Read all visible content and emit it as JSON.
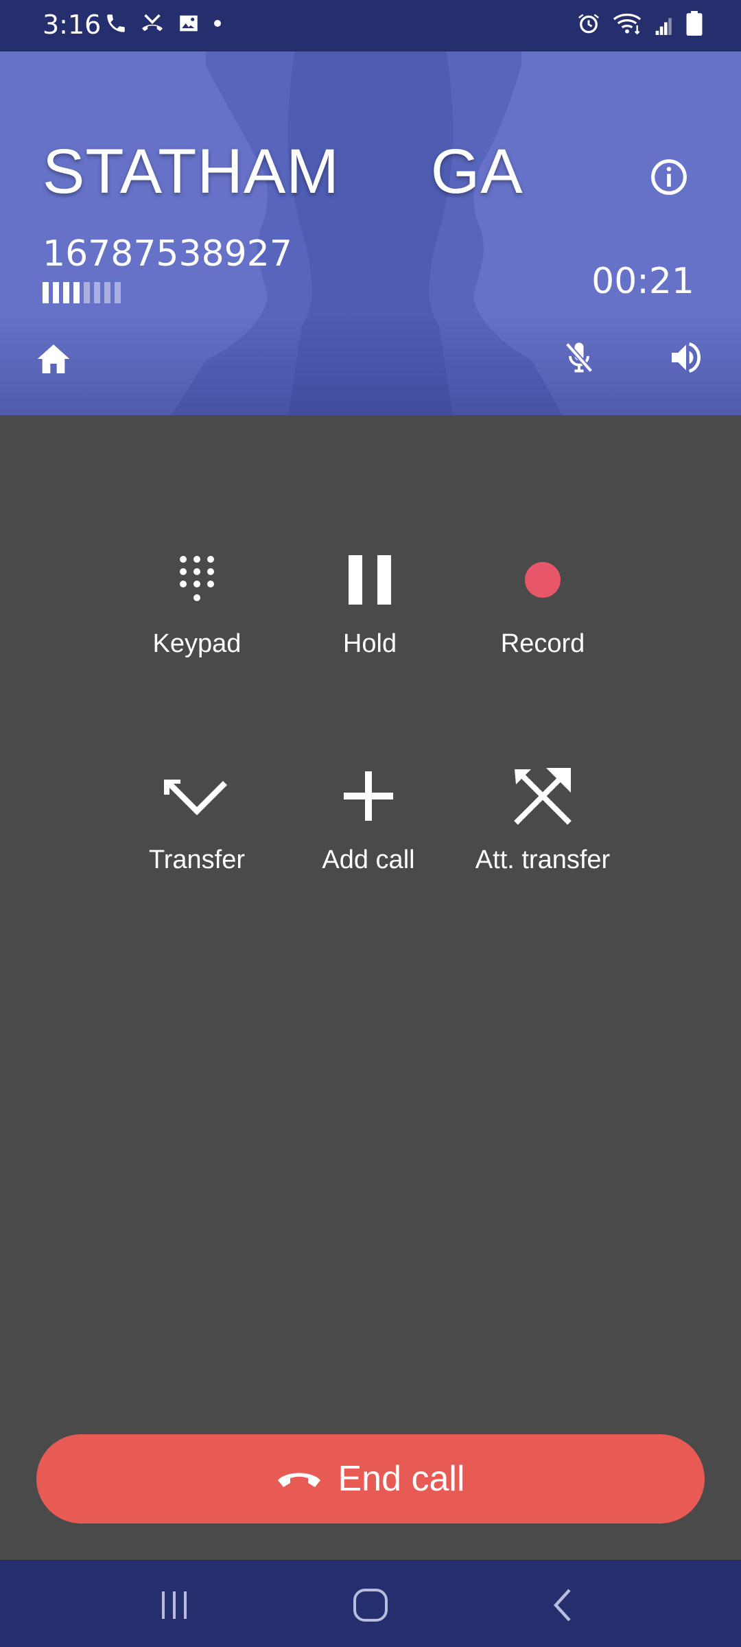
{
  "status_bar": {
    "time": "3:16",
    "icons_left": [
      "phone-icon",
      "missed-call-icon",
      "image-icon",
      "dot-icon"
    ],
    "icons_right": [
      "alarm-icon",
      "wifi-icon",
      "cell-signal-icon",
      "battery-icon"
    ]
  },
  "call": {
    "name": "STATHAM     GA",
    "number": "16787538927",
    "timer": "00:21",
    "signal_strength_level": 0.5
  },
  "header_actions": {
    "home_icon": "home-icon",
    "info_icon": "info-icon",
    "mute_icon": "mic-off-icon",
    "speaker_icon": "speaker-icon"
  },
  "actions": [
    {
      "label": "Keypad",
      "icon": "keypad-icon"
    },
    {
      "label": "Hold",
      "icon": "pause-icon"
    },
    {
      "label": "Record",
      "icon": "record-icon"
    },
    {
      "label": "Transfer",
      "icon": "transfer-icon"
    },
    {
      "label": "Add call",
      "icon": "add-icon"
    },
    {
      "label": "Att. transfer",
      "icon": "attended-transfer-icon"
    }
  ],
  "end_call": {
    "label": "End call",
    "icon": "end-call-icon"
  },
  "nav": {
    "buttons": [
      "recent-apps-icon",
      "home-nav-icon",
      "back-icon"
    ]
  },
  "colors": {
    "status_bar": "#262f6e",
    "header": "#6572c7",
    "background": "#4a4a4a",
    "record": "#e8566a",
    "end_call": "#e85b55"
  }
}
